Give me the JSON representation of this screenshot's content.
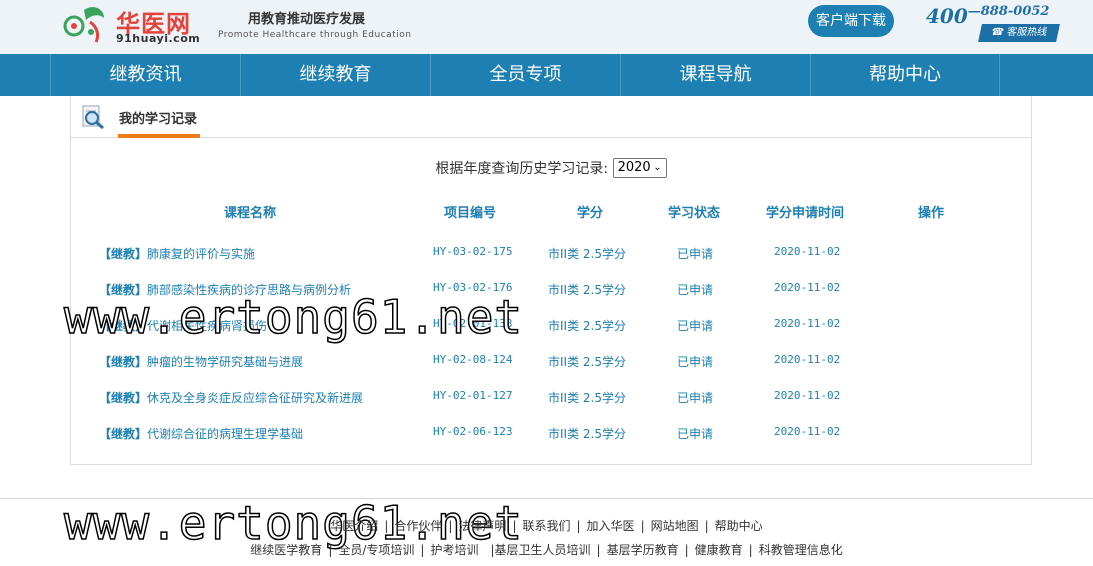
{
  "header": {
    "logo_cn": "华医网",
    "logo_en": "91huayi.com",
    "slogan_cn": "用教育推动医疗发展",
    "slogan_en": "Promote Healthcare through Education",
    "download_label": "客户端下载",
    "hotline_prefix": "400",
    "hotline_suffix": "888-0052",
    "hotline_tag": "客服热线"
  },
  "nav": {
    "items": [
      {
        "label": "继教资讯"
      },
      {
        "label": "继续教育"
      },
      {
        "label": "全员专项"
      },
      {
        "label": "课程导航"
      },
      {
        "label": "帮助中心"
      }
    ]
  },
  "panel": {
    "tab_label": "我的学习记录",
    "filter_label": "根据年度查询历史学习记录:",
    "selected_year": "2020",
    "columns": [
      "课程名称",
      "项目编号",
      "学分",
      "学习状态",
      "学分申请时间",
      "操作"
    ]
  },
  "records": [
    {
      "tag": "【继教】",
      "course": "肺康复的评价与实施",
      "code": "HY-03-02-175",
      "credit": "市II类 2.5学分",
      "status": "已申请",
      "date": "2020-11-02"
    },
    {
      "tag": "【继教】",
      "course": "肺部感染性疾病的诊疗思路与病例分析",
      "code": "HY-03-02-176",
      "credit": "市II类 2.5学分",
      "status": "已申请",
      "date": "2020-11-02"
    },
    {
      "tag": "【继教】",
      "course": "代谢相关性疾病肾损伤",
      "code": "HY-02-01-133",
      "credit": "市II类 2.5学分",
      "status": "已申请",
      "date": "2020-11-02"
    },
    {
      "tag": "【继教】",
      "course": "肿瘤的生物学研究基础与进展",
      "code": "HY-02-08-124",
      "credit": "市II类 2.5学分",
      "status": "已申请",
      "date": "2020-11-02"
    },
    {
      "tag": "【继教】",
      "course": "休克及全身炎症反应综合征研究及新进展",
      "code": "HY-02-01-127",
      "credit": "市II类 2.5学分",
      "status": "已申请",
      "date": "2020-11-02"
    },
    {
      "tag": "【继教】",
      "course": "代谢综合征的病理生理学基础",
      "code": "HY-02-06-123",
      "credit": "市II类 2.5学分",
      "status": "已申请",
      "date": "2020-11-02"
    }
  ],
  "watermark": {
    "line1": "www.ertong61.net",
    "line2": "www.ertong61.net"
  },
  "footer": {
    "row1": [
      "华医介绍",
      "合作伙伴",
      "法律声明",
      "联系我们",
      "加入华医",
      "网站地图",
      "帮助中心"
    ],
    "row2": [
      "继续医学教育",
      "全员/专项培训",
      "护考培训",
      "|基层卫生人员培训",
      "基层学历教育",
      "健康教育",
      "科教管理信息化"
    ]
  },
  "colors": {
    "brand_blue": "#1d7fb2",
    "logo_red": "#e4433b",
    "tab_underline": "#f07c1a"
  }
}
